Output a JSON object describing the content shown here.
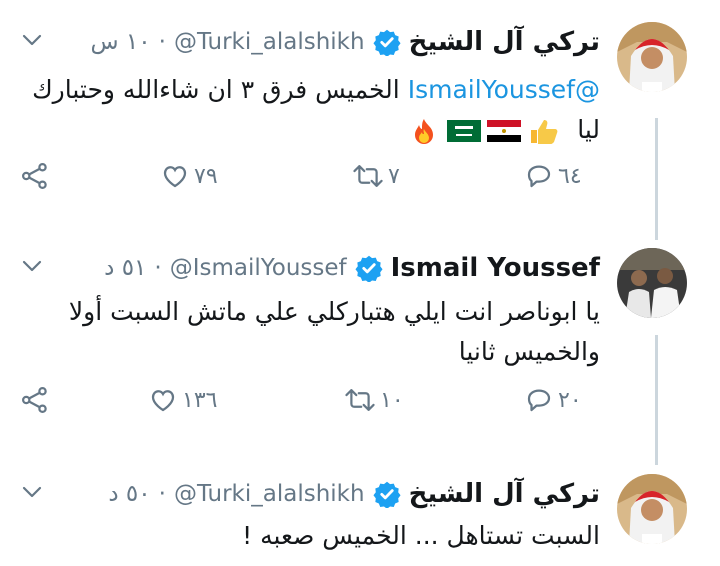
{
  "tweets": [
    {
      "name": "تركي آل الشيخ",
      "handle": "@Turki_alalshikh",
      "separator": "·",
      "time": "١٠ س",
      "mention": "@IsmailYoussef",
      "text": " الخميس فرق ٣ ان شاءالله وحتبارك",
      "line2": "ليا",
      "emojis": [
        "thumbs-up-icon",
        "egypt-flag-icon",
        "saudi-flag-icon",
        "fire-icon"
      ],
      "replies": "٦٤",
      "retweets": "٧",
      "likes": "٧٩"
    },
    {
      "name": "Ismail Youssef",
      "handle": "@IsmailYoussef",
      "separator": "·",
      "time": "٥١ د",
      "line1": "يا ابوناصر انت ايلي هتباركلي علي ماتش السبت أولا",
      "line2": "والخميس ثانيا",
      "replies": "٢٠",
      "retweets": "١٠",
      "likes": "١٣٦"
    },
    {
      "name": "تركي آل الشيخ",
      "handle": "@Turki_alalshikh",
      "separator": "·",
      "time": "٥٠ د",
      "line1": "السبت تستاهل ... الخميس صعبه !"
    }
  ],
  "colors": {
    "accent": "#1b95e0",
    "muted": "#657786",
    "line": "#ccd6dd"
  }
}
